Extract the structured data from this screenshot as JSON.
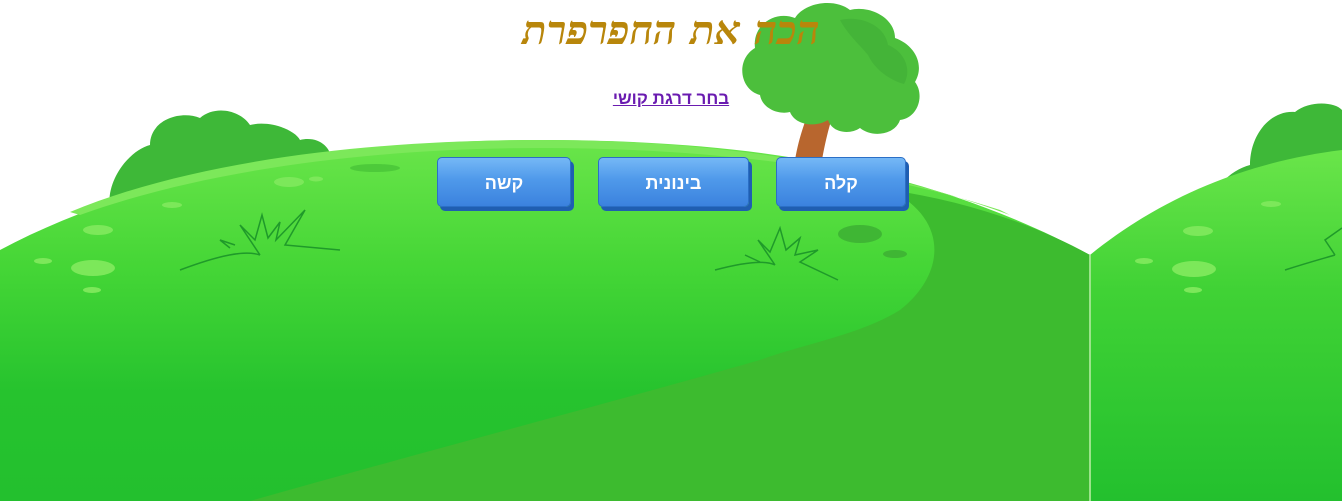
{
  "game": {
    "title": "הכה את החפרפרת",
    "subtitle": "בחר דרגת קושי",
    "buttons": {
      "easy": "קלה",
      "medium": "בינונית",
      "hard": "קשה"
    }
  },
  "colors": {
    "title": "#b8860b",
    "link": "#6a1bb0",
    "button": "#4f99ea",
    "grass_light": "#5fdc3c",
    "grass_dark": "#26c32e",
    "path": "#3dbb2f",
    "tree_trunk": "#b8662e",
    "tree_leaves": "#4cbf3c"
  },
  "icons": [
    "tree-icon",
    "grass-tuft-icon",
    "bush-icon"
  ]
}
